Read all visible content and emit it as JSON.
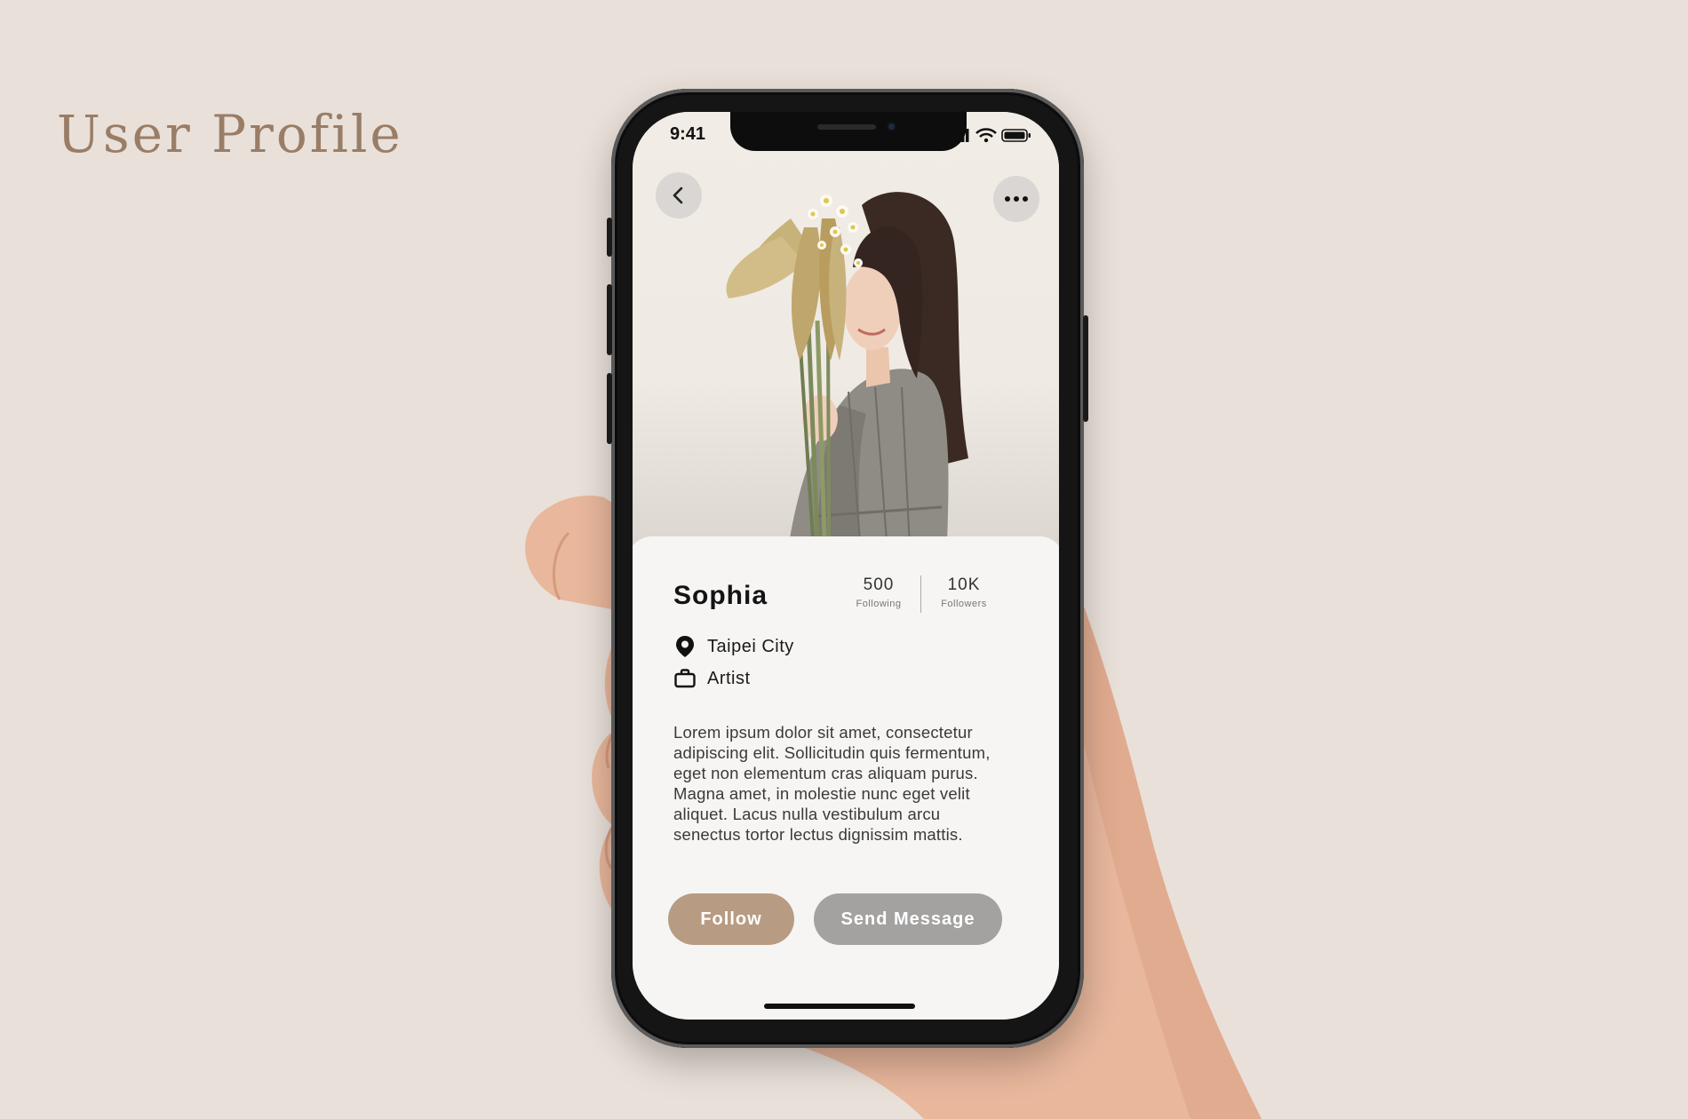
{
  "page": {
    "title": "User Profile"
  },
  "status_bar": {
    "time": "9:41"
  },
  "profile": {
    "name": "Sophia",
    "stats": {
      "following_value": "500",
      "following_label": "Following",
      "followers_value": "10K",
      "followers_label": "Followers"
    },
    "location": "Taipei City",
    "occupation": "Artist",
    "bio": "Lorem ipsum dolor sit amet, consectetur adipiscing elit. Sollicitudin quis fermentum, eget non elementum cras aliquam purus. Magna amet, in molestie nunc eget velit aliquet. Lacus nulla vestibulum arcu senectus tortor lectus dignissim mattis."
  },
  "actions": {
    "follow_label": "Follow",
    "message_label": "Send Message"
  },
  "icons": {
    "back": "chevron-left-icon",
    "more": "more-horizontal-icon",
    "location": "map-pin-icon",
    "occupation": "briefcase-icon",
    "signal": "signal-icon",
    "wifi": "wifi-icon",
    "battery": "battery-icon"
  },
  "colors": {
    "background": "#e9e0d9",
    "title": "#9a7d66",
    "follow_button": "#b79b83",
    "message_button": "#a3a2a1"
  }
}
